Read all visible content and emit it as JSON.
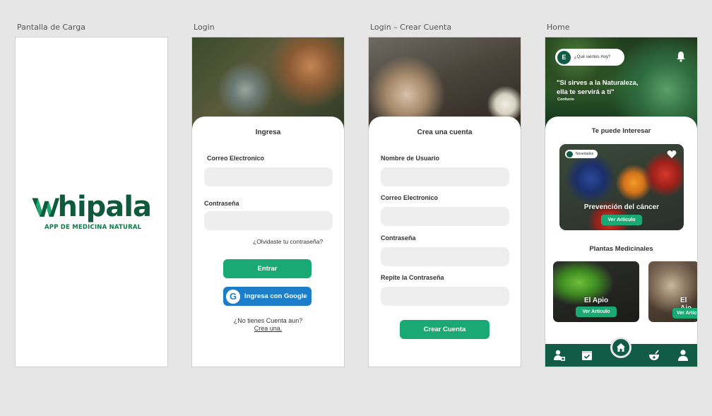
{
  "frames": {
    "splash": {
      "label": "Pantalla de Carga",
      "logo_text": "hipala",
      "logo_sub": "APP DE MEDICINA NATURAL"
    },
    "login": {
      "label": "Login",
      "title": "Ingresa",
      "email_label": "Correo Electronico",
      "password_label": "Contraseña",
      "forgot": "¿Olvidaste tu contraseña?",
      "enter_button": "Entrar",
      "google_button": "Ingresa con Google",
      "no_account": "¿No tienes Cuenta aun?",
      "create_link": "Crea una."
    },
    "signup": {
      "label": "Login – Crear Cuenta",
      "title": "Crea una cuenta",
      "username_label": "Nombre de Usuario",
      "email_label": "Correo Electronico",
      "password_label": "Contraseña",
      "repeat_label": "Repite la Contraseña",
      "create_button": "Crear Cuenta"
    },
    "home": {
      "label": "Home",
      "avatar_letter": "E",
      "search_placeholder": "¿Qué sientes Hoy?",
      "quote_line1": "\"Si sirves a la Naturaleza,",
      "quote_line2": "ella te servirá a ti\"",
      "quote_author": "Confucio",
      "interest_title": "Te puede Interesar",
      "feature_badge": "Novedades",
      "feature_title": "Prevención del cáncer",
      "feature_button": "Ver Articulo",
      "plants_title": "Plantas Medicinales",
      "plants": [
        {
          "title": "El Apio",
          "button": "Ver Articulo"
        },
        {
          "title": "El Ajo",
          "button": "Ver Artic"
        }
      ]
    }
  },
  "colors": {
    "brand_dark": "#125c45",
    "brand_green": "#1aa974",
    "google_blue": "#1c7ec9"
  }
}
